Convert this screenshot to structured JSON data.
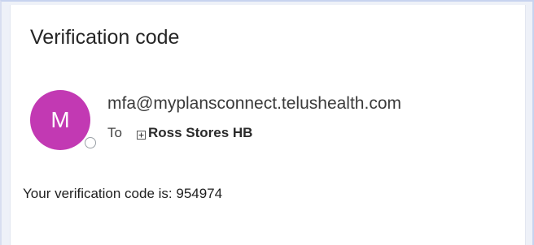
{
  "email": {
    "subject": "Verification code",
    "avatar_initial": "M",
    "avatar_color": "#c239b3",
    "presence_status": "offline",
    "sender": "mfa@myplansconnect.telushealth.com",
    "to_label": "To",
    "recipient_expand_icon": "plus-box-icon",
    "recipient": "Ross Stores HB",
    "body": "Your verification code is: 954974"
  }
}
